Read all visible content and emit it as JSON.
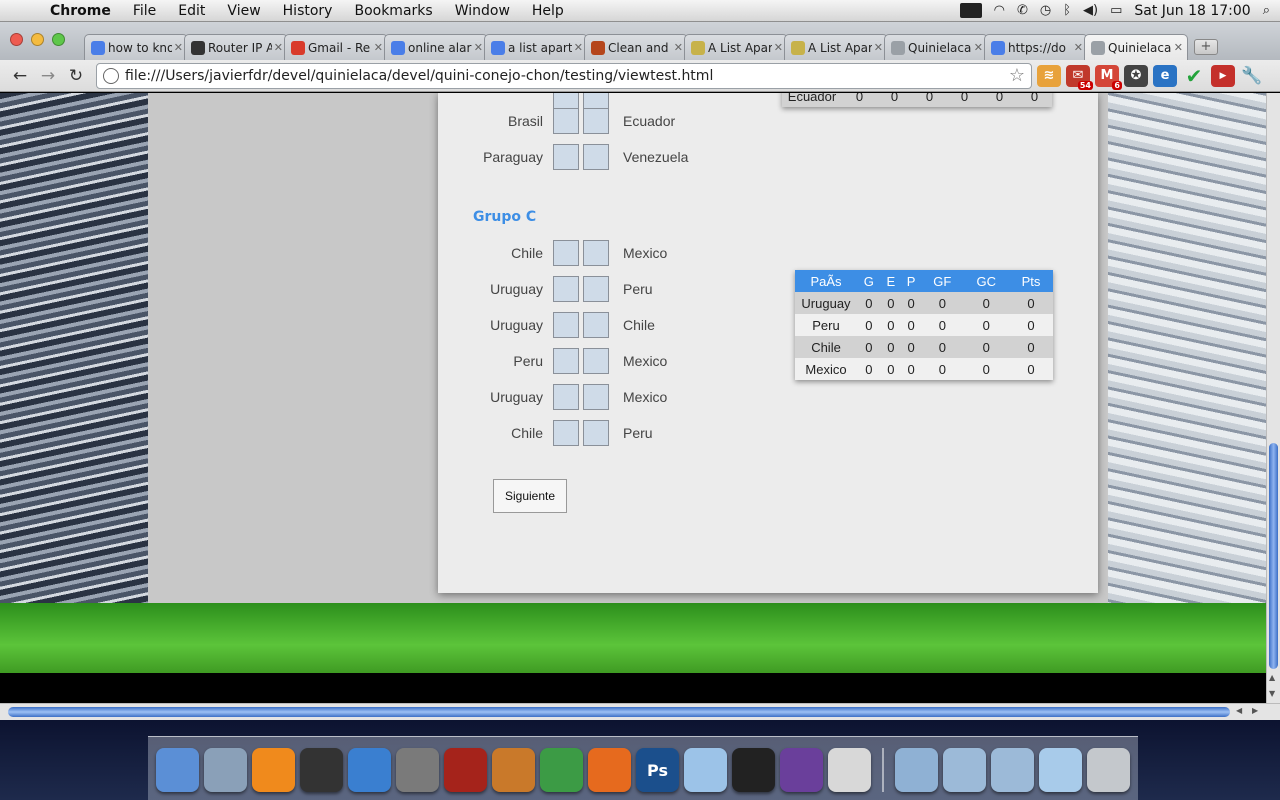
{
  "menubar": {
    "app": "Chrome",
    "items": [
      "File",
      "Edit",
      "View",
      "History",
      "Bookmarks",
      "Window",
      "Help"
    ],
    "clock": "Sat Jun 18  17:00"
  },
  "tabs": [
    {
      "title": "how to kno",
      "favicon": "google-icon",
      "color": "#4a7ee8"
    },
    {
      "title": "Router IP A",
      "favicon": "ip-icon",
      "color": "#333333"
    },
    {
      "title": "Gmail - Re",
      "favicon": "gmail-icon",
      "color": "#d93b2b"
    },
    {
      "title": "online alar",
      "favicon": "google-icon",
      "color": "#4a7ee8"
    },
    {
      "title": "a list apart",
      "favicon": "google-icon",
      "color": "#4a7ee8"
    },
    {
      "title": "Clean and",
      "favicon": "alistapart-icon",
      "color": "#b5461c"
    },
    {
      "title": "A List Apar",
      "favicon": "feather-icon",
      "color": "#c7b24a"
    },
    {
      "title": "A List Apar",
      "favicon": "feather-icon",
      "color": "#c7b24a"
    },
    {
      "title": "Quinielaca",
      "favicon": "globe-icon",
      "color": "#9aa0a6"
    },
    {
      "title": "https://do",
      "favicon": "google-icon",
      "color": "#4a7ee8"
    },
    {
      "title": "Quinielaca",
      "favicon": "globe-icon",
      "color": "#9aa0a6",
      "active": true
    }
  ],
  "toolbar": {
    "url": "file:///Users/javierfdr/devel/quinielaca/devel/quini-conejo-chon/testing/viewtest.html",
    "badges": {
      "mail_a": "54",
      "mail_b": "6"
    }
  },
  "page": {
    "groupB_matches": [
      {
        "home": "Brasil",
        "away": "Ecuador"
      },
      {
        "home": "Paraguay",
        "away": "Venezuela"
      }
    ],
    "groupB_partial_row": {
      "team": "Ecuador",
      "values": [
        "0",
        "0",
        "0",
        "0",
        "0",
        "0"
      ]
    },
    "groupC": {
      "title": "Grupo C",
      "matches": [
        {
          "home": "Chile",
          "away": "Mexico"
        },
        {
          "home": "Uruguay",
          "away": "Peru"
        },
        {
          "home": "Uruguay",
          "away": "Chile"
        },
        {
          "home": "Peru",
          "away": "Mexico"
        },
        {
          "home": "Uruguay",
          "away": "Mexico"
        },
        {
          "home": "Chile",
          "away": "Peru"
        }
      ],
      "standings_headers": [
        "PaÃs",
        "G",
        "E",
        "P",
        "GF",
        "GC",
        "Pts"
      ],
      "standings_rows": [
        {
          "team": "Uruguay",
          "values": [
            "0",
            "0",
            "0",
            "0",
            "0",
            "0"
          ]
        },
        {
          "team": "Peru",
          "values": [
            "0",
            "0",
            "0",
            "0",
            "0",
            "0"
          ]
        },
        {
          "team": "Chile",
          "values": [
            "0",
            "0",
            "0",
            "0",
            "0",
            "0"
          ]
        },
        {
          "team": "Mexico",
          "values": [
            "0",
            "0",
            "0",
            "0",
            "0",
            "0"
          ]
        }
      ]
    },
    "next_button": "Siguiente"
  },
  "colors": {
    "accent": "#3d8ee5",
    "score_box": "#cfdbe8"
  },
  "dock": [
    {
      "name": "finder-icon",
      "color": "#5b8fd6"
    },
    {
      "name": "mail-icon",
      "color": "#8aa0b8"
    },
    {
      "name": "vlc-icon",
      "color": "#f08a1c"
    },
    {
      "name": "dashboard-icon",
      "color": "#333333"
    },
    {
      "name": "safari-icon",
      "color": "#3a7fd0"
    },
    {
      "name": "system-preferences-icon",
      "color": "#7a7a7a"
    },
    {
      "name": "photo-booth-icon",
      "color": "#a5231b"
    },
    {
      "name": "keynote-icon",
      "color": "#c9792a"
    },
    {
      "name": "chrome-icon",
      "color": "#3c9b45"
    },
    {
      "name": "firefox-icon",
      "color": "#e66a1e"
    },
    {
      "name": "photoshop-icon",
      "color": "#1b4f8c",
      "label": "Ps"
    },
    {
      "name": "virtualbox-icon",
      "color": "#9cc3e8"
    },
    {
      "name": "terminal-icon",
      "color": "#222222"
    },
    {
      "name": "visual-studio-icon",
      "color": "#6a3f9b"
    },
    {
      "name": "css-edit-icon",
      "color": "#d8d8d8"
    },
    {
      "name": "applications-folder-icon",
      "color": "#8fb1d4"
    },
    {
      "name": "documents-folder-icon",
      "color": "#9cbad8"
    },
    {
      "name": "downloads-folder-icon",
      "color": "#9cbad8"
    },
    {
      "name": "virtualbox-vm-icon",
      "color": "#a8cbea"
    },
    {
      "name": "trash-icon",
      "color": "#c4c8cc"
    }
  ]
}
